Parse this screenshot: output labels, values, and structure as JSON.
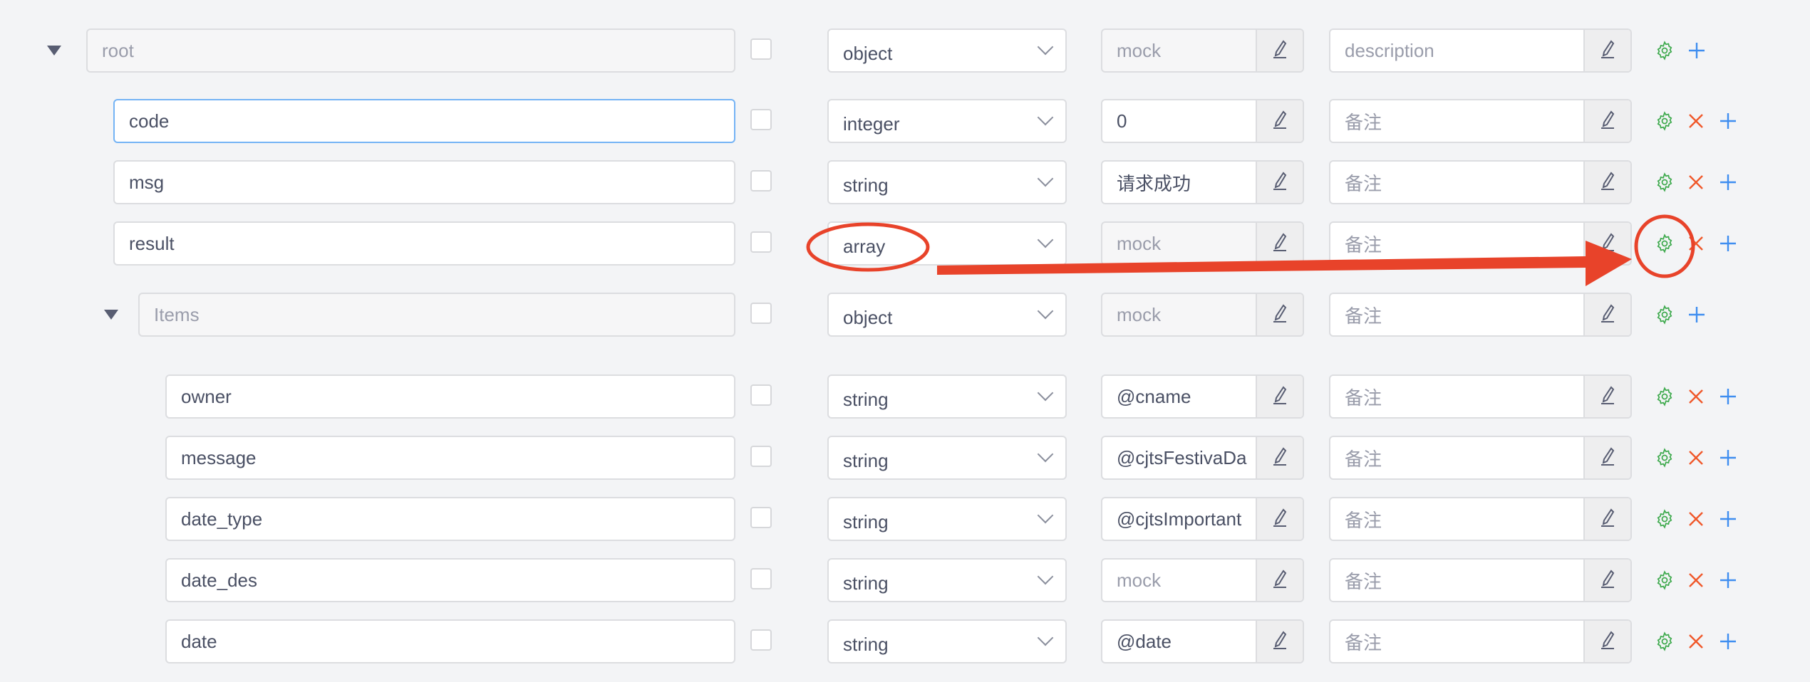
{
  "colors": {
    "gear": "#3faa4e",
    "delete": "#f0582a",
    "add": "#3f8ef0",
    "annotation": "#e8432a"
  },
  "rows": [
    {
      "level": 0,
      "expand": true,
      "name": "root",
      "name_placeholder": true,
      "name_disabled": true,
      "type": "object",
      "mock": "mock",
      "mock_placeholder": true,
      "mock_disabled": true,
      "desc": "description",
      "delete": false
    },
    {
      "level": 1,
      "name": "code",
      "focused": true,
      "type": "integer",
      "mock": "0",
      "desc": "备注",
      "delete": true
    },
    {
      "level": 1,
      "name": "msg",
      "type": "string",
      "mock": "请求成功",
      "desc": "备注",
      "delete": true
    },
    {
      "level": 1,
      "name": "result",
      "type": "array",
      "mock": "mock",
      "mock_placeholder": true,
      "mock_disabled": true,
      "desc": "备注",
      "delete": true
    },
    {
      "level": 2,
      "expand": true,
      "name": "Items",
      "name_placeholder": true,
      "name_disabled": true,
      "type": "object",
      "mock": "mock",
      "mock_placeholder": true,
      "mock_disabled": true,
      "desc": "备注",
      "delete": false
    },
    {
      "level": 3,
      "name": "owner",
      "type": "string",
      "mock": "@cname",
      "desc": "备注",
      "delete": true
    },
    {
      "level": 3,
      "name": "message",
      "type": "string",
      "mock": "@cjtsFestivaDa",
      "desc": "备注",
      "delete": true
    },
    {
      "level": 3,
      "name": "date_type",
      "type": "string",
      "mock": "@cjtsImportant",
      "desc": "备注",
      "delete": true
    },
    {
      "level": 3,
      "name": "date_des",
      "type": "string",
      "mock": "mock",
      "mock_placeholder": true,
      "desc": "备注",
      "delete": true
    },
    {
      "level": 3,
      "name": "date",
      "type": "string",
      "mock": "@date",
      "desc": "备注",
      "delete": true
    }
  ]
}
